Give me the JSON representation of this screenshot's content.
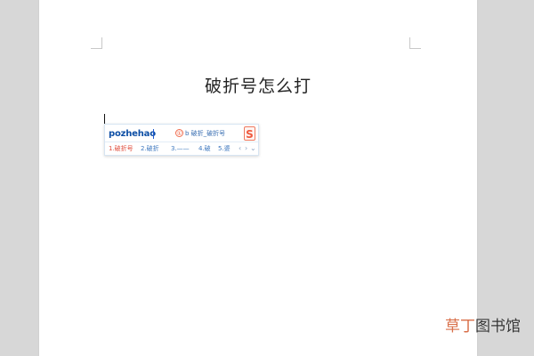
{
  "document": {
    "title": "破折号怎么打"
  },
  "ime": {
    "pinyin": "pozhehao",
    "tip_icon": "①",
    "tip": "b 破折_破折号",
    "logo": "S",
    "candidates": [
      "1.破折号",
      "2.破折",
      "3.——",
      "4.破",
      "5.婆"
    ],
    "page_controls": {
      "prev": "‹",
      "next": "›",
      "more": "⌄"
    }
  },
  "watermark": {
    "accent": "草丁",
    "dark": "图书馆"
  },
  "colors": {
    "background": "#d7d7d7",
    "page": "#ffffff",
    "ime_blue": "#3e78bf",
    "ime_red": "#e04e3d",
    "watermark_accent": "#d96f49"
  }
}
